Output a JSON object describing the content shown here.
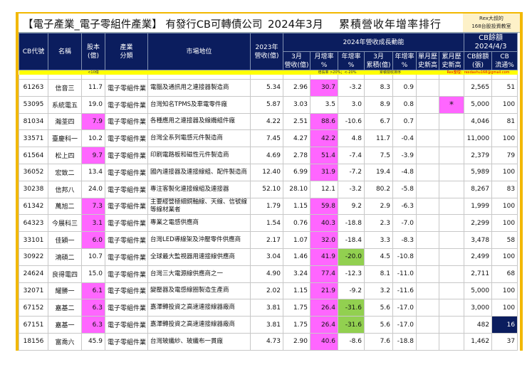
{
  "title": {
    "main": "【電子產業_電子零組件產業】 有發行CB可轉債公司",
    "period": "2024年3月",
    "ranking": "累積營收年增率排行",
    "author_line1": "Rex大叔的",
    "author_line2": "168台股投資教室"
  },
  "headers": {
    "code": "CB代號",
    "name": "名稱",
    "capital": "股本\n(億)",
    "industry": "產業\n分類",
    "market": "市場地位",
    "rev2023": "2023年\n營收(億)",
    "group_growth": "2024年營收成長動能",
    "group_cb": "CB餘額\n2024/4/3",
    "mar_rev": "3月\n營收(億)",
    "mom": "月增率\n%",
    "yoy": "年增率\n%",
    "mar_cum": "3月\n累積(億)",
    "cum_yoy": "年增率\n%",
    "month_high": "單月歷\n史新高",
    "cum_high": "累月歷\n史新高",
    "cb_balance": "CB餘額\n(張)",
    "cb_circ": "CB\n流通%"
  },
  "notes": {
    "capital": "<10億",
    "growth": "增長率 >20%；<-20%",
    "sort": "累積營收排序",
    "contact": "Rex整理：rexdashu168@gmail.com"
  },
  "colors": {
    "header": "#0b1d5e",
    "highlight_pink": "#ff66ff",
    "highlight_green": "#92d050",
    "frame": "#f2b800"
  },
  "rows": [
    {
      "code": "61263",
      "name": "信音三",
      "capital": "11.7",
      "industry": "電子零組件業",
      "market": "電腦及通訊用之連接器製造商",
      "rev2023": "5.34",
      "mar_rev": "2.96",
      "mom": "30.7",
      "yoy": "-3.2",
      "mar_cum": "8.3",
      "cum_yoy": "0.9",
      "month_high": "",
      "cum_high": "",
      "cb_balance": "2,565",
      "cb_circ": "51"
    },
    {
      "code": "53095",
      "name": "系統電五",
      "capital": "19.0",
      "industry": "電子零組件業",
      "market": "台灣知名TPMS及車電零件廠",
      "rev2023": "5.87",
      "mar_rev": "3.03",
      "mom": "3.5",
      "yoy": "3.0",
      "mar_cum": "8.9",
      "cum_yoy": "0.8",
      "month_high": "",
      "cum_high": "*",
      "cb_balance": "5,000",
      "cb_circ": "100"
    },
    {
      "code": "81034",
      "name": "瀚荃四",
      "capital": "7.9",
      "industry": "電子零組件業",
      "market": "各種應用之連接器及線纜組件廠",
      "rev2023": "4.22",
      "mar_rev": "2.51",
      "mom": "88.6",
      "yoy": "-10.6",
      "mar_cum": "6.7",
      "cum_yoy": "0.7",
      "month_high": "",
      "cum_high": "",
      "cb_balance": "4,046",
      "cb_circ": "81"
    },
    {
      "code": "33571",
      "name": "臺慶科一",
      "capital": "10.2",
      "industry": "電子零組件業",
      "market": "台灣全系列電感元件製造商",
      "rev2023": "7.45",
      "mar_rev": "4.27",
      "mom": "42.2",
      "yoy": "4.8",
      "mar_cum": "11.7",
      "cum_yoy": "-0.4",
      "month_high": "",
      "cum_high": "",
      "cb_balance": "11,000",
      "cb_circ": "100"
    },
    {
      "code": "61564",
      "name": "松上四",
      "capital": "9.7",
      "industry": "電子零組件業",
      "market": "印刷電路板和磁性元件製造商",
      "rev2023": "4.69",
      "mar_rev": "2.78",
      "mom": "51.4",
      "yoy": "-7.4",
      "mar_cum": "7.5",
      "cum_yoy": "-3.9",
      "month_high": "",
      "cum_high": "",
      "cb_balance": "2,379",
      "cb_circ": "79"
    },
    {
      "code": "36052",
      "name": "宏致二",
      "capital": "13.4",
      "industry": "電子零組件業",
      "market": "國內連接器及連接線組、配件製造商",
      "rev2023": "12.40",
      "mar_rev": "6.99",
      "mom": "31.9",
      "yoy": "-7.2",
      "mar_cum": "19.4",
      "cum_yoy": "-4.8",
      "month_high": "",
      "cum_high": "",
      "cb_balance": "5,989",
      "cb_circ": "100"
    },
    {
      "code": "30238",
      "name": "信邦八",
      "capital": "24.0",
      "industry": "電子零組件業",
      "market": "專注客製化連接線組及連接器",
      "rev2023": "52.10",
      "mar_rev": "28.10",
      "mom": "12.1",
      "yoy": "-3.2",
      "mar_cum": "80.2",
      "cum_yoy": "-5.8",
      "month_high": "",
      "cum_high": "",
      "cb_balance": "8,267",
      "cb_circ": "83"
    },
    {
      "code": "61342",
      "name": "萬旭二",
      "capital": "7.3",
      "industry": "電子零組件業",
      "market": "主要經營極細銅軸線、天線、信號線等線材業者",
      "rev2023": "1.79",
      "mar_rev": "1.15",
      "mom": "59.8",
      "yoy": "9.2",
      "mar_cum": "2.9",
      "cum_yoy": "-6.3",
      "month_high": "",
      "cum_high": "",
      "cb_balance": "1,999",
      "cb_circ": "100"
    },
    {
      "code": "64323",
      "name": "今展科三",
      "capital": "3.1",
      "industry": "電子零組件業",
      "market": "專業之電感供應商",
      "rev2023": "1.54",
      "mar_rev": "0.76",
      "mom": "40.3",
      "yoy": "-18.8",
      "mar_cum": "2.3",
      "cum_yoy": "-7.0",
      "month_high": "",
      "cum_high": "",
      "cb_balance": "2,299",
      "cb_circ": "100"
    },
    {
      "code": "33101",
      "name": "佳穎一",
      "capital": "6.0",
      "industry": "電子零組件業",
      "market": "台灣LED導線架及沖壓零件供應商",
      "rev2023": "2.17",
      "mar_rev": "1.07",
      "mom": "32.0",
      "yoy": "-18.4",
      "mar_cum": "3.3",
      "cum_yoy": "-8.3",
      "month_high": "",
      "cum_high": "",
      "cb_balance": "3,478",
      "cb_circ": "58"
    },
    {
      "code": "30922",
      "name": "鴻碩二",
      "capital": "10.7",
      "industry": "電子零組件業",
      "market": "全球最大監視器用連接線供應商",
      "rev2023": "3.04",
      "mar_rev": "1.46",
      "mom": "41.9",
      "yoy": "-20.0",
      "mar_cum": "4.5",
      "cum_yoy": "-10.8",
      "month_high": "",
      "cum_high": "",
      "cb_balance": "2,499",
      "cb_circ": "100"
    },
    {
      "code": "24624",
      "name": "良得電四",
      "capital": "15.0",
      "industry": "電子零組件業",
      "market": "台灣三大電源線供應商之一",
      "rev2023": "4.90",
      "mar_rev": "3.24",
      "mom": "77.4",
      "yoy": "-12.3",
      "mar_cum": "8.1",
      "cum_yoy": "-11.0",
      "month_high": "",
      "cum_high": "",
      "cb_balance": "2,711",
      "cb_circ": "68"
    },
    {
      "code": "32071",
      "name": "耀勝一",
      "capital": "6.1",
      "industry": "電子零組件業",
      "market": "變壓器及電感線圈製造生產商",
      "rev2023": "2.02",
      "mar_rev": "1.15",
      "mom": "21.9",
      "yoy": "-9.2",
      "mar_cum": "3.2",
      "cum_yoy": "-11.6",
      "month_high": "",
      "cum_high": "",
      "cb_balance": "5,000",
      "cb_circ": "100"
    },
    {
      "code": "67152",
      "name": "嘉基二",
      "capital": "6.3",
      "industry": "電子零組件業",
      "market": "嘉澤轉投資之高速連接線器廠商",
      "rev2023": "3.81",
      "mar_rev": "1.75",
      "mom": "26.4",
      "yoy": "-31.6",
      "mar_cum": "5.6",
      "cum_yoy": "-17.0",
      "month_high": "",
      "cum_high": "",
      "cb_balance": "3,000",
      "cb_circ": "100"
    },
    {
      "code": "67151",
      "name": "嘉基一",
      "capital": "6.3",
      "industry": "電子零組件業",
      "market": "嘉澤轉投資之高速連接線器廠商",
      "rev2023": "3.81",
      "mar_rev": "1.75",
      "mom": "26.4",
      "yoy": "-31.6",
      "mar_cum": "5.6",
      "cum_yoy": "-17.0",
      "month_high": "",
      "cum_high": "",
      "cb_balance": "482",
      "cb_circ": "16",
      "cb_circ_highlight": true
    },
    {
      "code": "18156",
      "name": "富喬六",
      "capital": "45.9",
      "industry": "電子零組件業",
      "market": "台灣玻纖紗、玻纖布一貫廠",
      "rev2023": "4.73",
      "mar_rev": "2.90",
      "mom": "40.6",
      "yoy": "-8.6",
      "mar_cum": "7.6",
      "cum_yoy": "-18.8",
      "month_high": "",
      "cum_high": "",
      "cb_balance": "1,462",
      "cb_circ": "37"
    }
  ]
}
